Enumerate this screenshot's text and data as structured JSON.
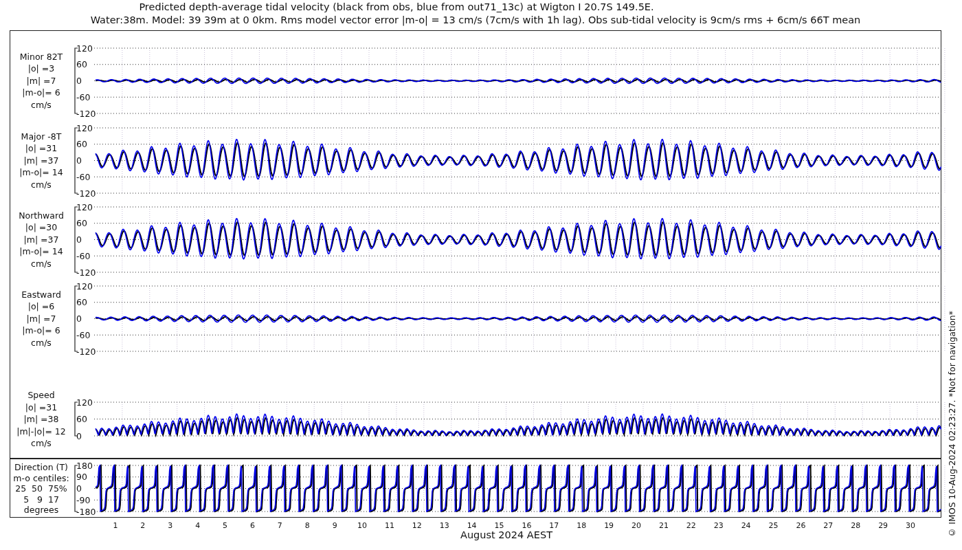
{
  "title_lines": [
    "Predicted depth-average tidal velocity (black from obs, blue from out71_13c) at Wigton I 20.7S 149.5E.",
    "Water:38m. Model: 39 39m at 0 0km. Rms model vector error |m-o| = 13 cm/s (7cm/s with 1h lag). Obs sub-tidal velocity is 9cm/s rms + 6cm/s 66T mean"
  ],
  "panels": [
    {
      "kind": "minor",
      "label_lines": [
        "Minor 82T",
        "|o| =3",
        "|m| =7",
        "|m-o|= 6",
        "cm/s"
      ],
      "yticks": [
        "120",
        "60",
        "0",
        "-60",
        "-120"
      ]
    },
    {
      "kind": "major",
      "label_lines": [
        "Major -8T",
        "|o| =31",
        "|m| =37",
        "|m-o|= 14",
        "cm/s"
      ],
      "yticks": [
        "120",
        "60",
        "0",
        "-60",
        "-120"
      ]
    },
    {
      "kind": "northward",
      "label_lines": [
        "Northward",
        "|o| =30",
        "|m| =37",
        "|m-o|= 14",
        "cm/s"
      ],
      "yticks": [
        "120",
        "60",
        "0",
        "-60",
        "-120"
      ]
    },
    {
      "kind": "eastward",
      "label_lines": [
        "Eastward",
        "|o| =6",
        "|m| =7",
        "|m-o|= 6",
        "cm/s"
      ],
      "yticks": [
        "120",
        "60",
        "0",
        "-60",
        "-120"
      ]
    },
    {
      "kind": "speed",
      "label_lines": [
        "Speed",
        "|o| =31",
        "|m| =38",
        "|m|-|o|= 12",
        "cm/s"
      ],
      "yticks": [
        "120",
        "60",
        "0"
      ]
    },
    {
      "kind": "direction",
      "label_lines": [
        "Direction (T)",
        "m-o centiles:",
        "25  50  75%",
        "5   9  17",
        "degrees"
      ],
      "yticks": [
        "180",
        "90",
        "0",
        "-90",
        "-180"
      ]
    }
  ],
  "x_axis": {
    "day_labels": [
      "1",
      "2",
      "3",
      "4",
      "5",
      "6",
      "7",
      "8",
      "9",
      "10",
      "11",
      "12",
      "13",
      "14",
      "15",
      "16",
      "17",
      "18",
      "19",
      "20",
      "21",
      "22",
      "23",
      "24",
      "25",
      "26",
      "27",
      "28",
      "29",
      "30"
    ],
    "title": "August 2024 AEST"
  },
  "side_note": "© IMOS 10-Aug-2024 02:23:27. *Not for navigation*"
}
